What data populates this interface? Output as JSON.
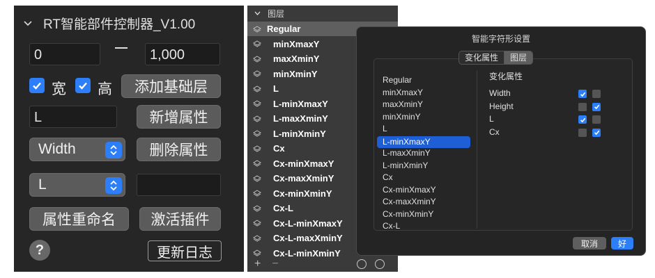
{
  "left_panel": {
    "title": "RT智能部件控制器_V1.00",
    "range_from": "0",
    "range_to": "1,000",
    "width_label": "宽",
    "height_label": "高",
    "width_checked": true,
    "height_checked": true,
    "add_base_layer": "添加基础层",
    "attr_input_value": "L",
    "add_attr": "新增属性",
    "axis_select": "Width",
    "delete_attr": "删除属性",
    "value_select": "L",
    "value_input": "",
    "rename_attr": "属性重命名",
    "activate_plugin": "激活插件",
    "help": "?",
    "changelog": "更新日志"
  },
  "layers": {
    "header": "图层",
    "items": [
      {
        "label": "Regular",
        "selected": true,
        "sub": false
      },
      {
        "label": "minXmaxY",
        "selected": false,
        "sub": true
      },
      {
        "label": "maxXminY",
        "selected": false,
        "sub": true
      },
      {
        "label": "minXminY",
        "selected": false,
        "sub": true
      },
      {
        "label": "L",
        "selected": false,
        "sub": true
      },
      {
        "label": "L-minXmaxY",
        "selected": false,
        "sub": true
      },
      {
        "label": "L-maxXminY",
        "selected": false,
        "sub": true
      },
      {
        "label": "L-minXminY",
        "selected": false,
        "sub": true
      },
      {
        "label": "Cx",
        "selected": false,
        "sub": true
      },
      {
        "label": "Cx-minXmaxY",
        "selected": false,
        "sub": true
      },
      {
        "label": "Cx-maxXminY",
        "selected": false,
        "sub": true
      },
      {
        "label": "Cx-minXminY",
        "selected": false,
        "sub": true
      },
      {
        "label": "Cx-L",
        "selected": false,
        "sub": true
      },
      {
        "label": "Cx-L-minXmaxY",
        "selected": false,
        "sub": true
      },
      {
        "label": "Cx-L-maxXminY",
        "selected": false,
        "sub": true
      },
      {
        "label": "Cx-L-minXminY",
        "selected": false,
        "sub": true
      }
    ],
    "add": "+",
    "remove": "−"
  },
  "dialog": {
    "title": "智能字符形设置",
    "tabs": [
      "变化属性",
      "图层"
    ],
    "active_tab": "图层",
    "layer_options": [
      "Regular",
      "minXmaxY",
      "maxXminY",
      "minXminY",
      "L",
      "L-minXmaxY",
      "L-maxXminY",
      "L-minXminY",
      "Cx",
      "Cx-minXmaxY",
      "Cx-maxXminY",
      "Cx-minXminY",
      "Cx-L"
    ],
    "selected_option": "L-minXmaxY",
    "props_header": "变化属性",
    "props": [
      {
        "name": "Width",
        "min": true,
        "max": false
      },
      {
        "name": "Height",
        "min": false,
        "max": true
      },
      {
        "name": "L",
        "min": true,
        "max": false
      },
      {
        "name": "Cx",
        "min": false,
        "max": true
      }
    ],
    "cancel": "取消",
    "ok": "好"
  },
  "colors": {
    "accent": "#2d7ff9",
    "panel_bg": "#262626",
    "layer_bg": "#3a3a3a",
    "button_bg": "#5b5b5b"
  }
}
